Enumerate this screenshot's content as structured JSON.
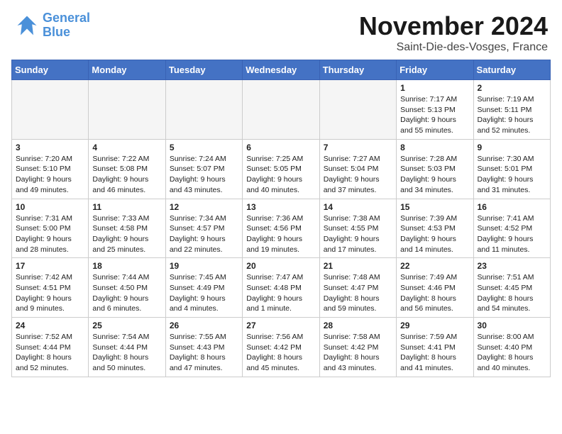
{
  "header": {
    "logo_line1": "General",
    "logo_line2": "Blue",
    "month_title": "November 2024",
    "location": "Saint-Die-des-Vosges, France"
  },
  "weekdays": [
    "Sunday",
    "Monday",
    "Tuesday",
    "Wednesday",
    "Thursday",
    "Friday",
    "Saturday"
  ],
  "weeks": [
    [
      {
        "day": "",
        "info": ""
      },
      {
        "day": "",
        "info": ""
      },
      {
        "day": "",
        "info": ""
      },
      {
        "day": "",
        "info": ""
      },
      {
        "day": "",
        "info": ""
      },
      {
        "day": "1",
        "info": "Sunrise: 7:17 AM\nSunset: 5:13 PM\nDaylight: 9 hours and 55 minutes."
      },
      {
        "day": "2",
        "info": "Sunrise: 7:19 AM\nSunset: 5:11 PM\nDaylight: 9 hours and 52 minutes."
      }
    ],
    [
      {
        "day": "3",
        "info": "Sunrise: 7:20 AM\nSunset: 5:10 PM\nDaylight: 9 hours and 49 minutes."
      },
      {
        "day": "4",
        "info": "Sunrise: 7:22 AM\nSunset: 5:08 PM\nDaylight: 9 hours and 46 minutes."
      },
      {
        "day": "5",
        "info": "Sunrise: 7:24 AM\nSunset: 5:07 PM\nDaylight: 9 hours and 43 minutes."
      },
      {
        "day": "6",
        "info": "Sunrise: 7:25 AM\nSunset: 5:05 PM\nDaylight: 9 hours and 40 minutes."
      },
      {
        "day": "7",
        "info": "Sunrise: 7:27 AM\nSunset: 5:04 PM\nDaylight: 9 hours and 37 minutes."
      },
      {
        "day": "8",
        "info": "Sunrise: 7:28 AM\nSunset: 5:03 PM\nDaylight: 9 hours and 34 minutes."
      },
      {
        "day": "9",
        "info": "Sunrise: 7:30 AM\nSunset: 5:01 PM\nDaylight: 9 hours and 31 minutes."
      }
    ],
    [
      {
        "day": "10",
        "info": "Sunrise: 7:31 AM\nSunset: 5:00 PM\nDaylight: 9 hours and 28 minutes."
      },
      {
        "day": "11",
        "info": "Sunrise: 7:33 AM\nSunset: 4:58 PM\nDaylight: 9 hours and 25 minutes."
      },
      {
        "day": "12",
        "info": "Sunrise: 7:34 AM\nSunset: 4:57 PM\nDaylight: 9 hours and 22 minutes."
      },
      {
        "day": "13",
        "info": "Sunrise: 7:36 AM\nSunset: 4:56 PM\nDaylight: 9 hours and 19 minutes."
      },
      {
        "day": "14",
        "info": "Sunrise: 7:38 AM\nSunset: 4:55 PM\nDaylight: 9 hours and 17 minutes."
      },
      {
        "day": "15",
        "info": "Sunrise: 7:39 AM\nSunset: 4:53 PM\nDaylight: 9 hours and 14 minutes."
      },
      {
        "day": "16",
        "info": "Sunrise: 7:41 AM\nSunset: 4:52 PM\nDaylight: 9 hours and 11 minutes."
      }
    ],
    [
      {
        "day": "17",
        "info": "Sunrise: 7:42 AM\nSunset: 4:51 PM\nDaylight: 9 hours and 9 minutes."
      },
      {
        "day": "18",
        "info": "Sunrise: 7:44 AM\nSunset: 4:50 PM\nDaylight: 9 hours and 6 minutes."
      },
      {
        "day": "19",
        "info": "Sunrise: 7:45 AM\nSunset: 4:49 PM\nDaylight: 9 hours and 4 minutes."
      },
      {
        "day": "20",
        "info": "Sunrise: 7:47 AM\nSunset: 4:48 PM\nDaylight: 9 hours and 1 minute."
      },
      {
        "day": "21",
        "info": "Sunrise: 7:48 AM\nSunset: 4:47 PM\nDaylight: 8 hours and 59 minutes."
      },
      {
        "day": "22",
        "info": "Sunrise: 7:49 AM\nSunset: 4:46 PM\nDaylight: 8 hours and 56 minutes."
      },
      {
        "day": "23",
        "info": "Sunrise: 7:51 AM\nSunset: 4:45 PM\nDaylight: 8 hours and 54 minutes."
      }
    ],
    [
      {
        "day": "24",
        "info": "Sunrise: 7:52 AM\nSunset: 4:44 PM\nDaylight: 8 hours and 52 minutes."
      },
      {
        "day": "25",
        "info": "Sunrise: 7:54 AM\nSunset: 4:44 PM\nDaylight: 8 hours and 50 minutes."
      },
      {
        "day": "26",
        "info": "Sunrise: 7:55 AM\nSunset: 4:43 PM\nDaylight: 8 hours and 47 minutes."
      },
      {
        "day": "27",
        "info": "Sunrise: 7:56 AM\nSunset: 4:42 PM\nDaylight: 8 hours and 45 minutes."
      },
      {
        "day": "28",
        "info": "Sunrise: 7:58 AM\nSunset: 4:42 PM\nDaylight: 8 hours and 43 minutes."
      },
      {
        "day": "29",
        "info": "Sunrise: 7:59 AM\nSunset: 4:41 PM\nDaylight: 8 hours and 41 minutes."
      },
      {
        "day": "30",
        "info": "Sunrise: 8:00 AM\nSunset: 4:40 PM\nDaylight: 8 hours and 40 minutes."
      }
    ]
  ]
}
